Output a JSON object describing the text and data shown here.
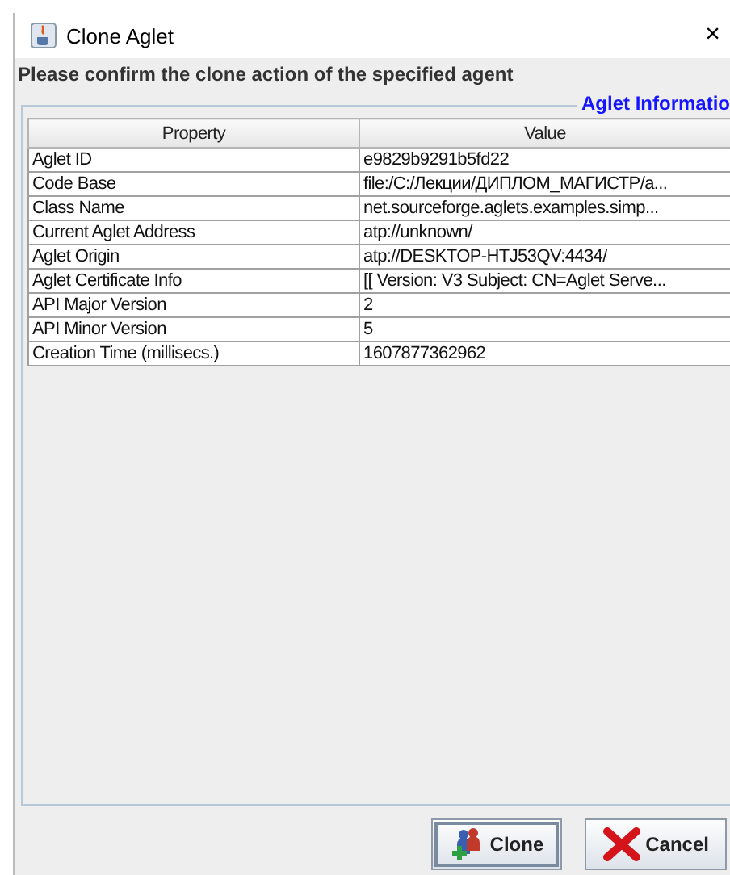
{
  "window": {
    "title": "Clone Aglet",
    "close": "×"
  },
  "prompt": "Please confirm the clone action of the specified agent",
  "group": {
    "title": "Aglet Informatio"
  },
  "table": {
    "columns": [
      "Property",
      "Value"
    ],
    "rows": [
      [
        "Aglet ID",
        "e9829b9291b5fd22"
      ],
      [
        "Code Base",
        "file:/C:/Лекции/ДИПЛОМ_МАГИСТР/a..."
      ],
      [
        "Class Name",
        "net.sourceforge.aglets.examples.simp..."
      ],
      [
        "Current Aglet Address",
        "atp://unknown/"
      ],
      [
        "Aglet Origin",
        "atp://DESKTOP-HTJ53QV:4434/"
      ],
      [
        "Aglet Certificate Info",
        "[[  Version: V3  Subject: CN=Aglet Serve..."
      ],
      [
        "API Major Version",
        "2"
      ],
      [
        "API Minor Version",
        "5"
      ],
      [
        "Creation Time (millisecs.)",
        "1607877362962"
      ]
    ]
  },
  "buttons": [
    {
      "label": "Clone",
      "kind": "clone",
      "focused": true
    },
    {
      "label": "Cancel",
      "kind": "cancel",
      "focused": false
    }
  ]
}
